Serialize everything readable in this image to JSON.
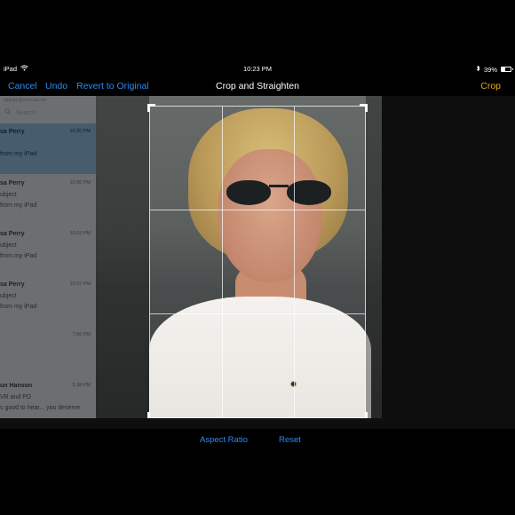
{
  "status_bar": {
    "device": "iPad",
    "time": "10:23 PM",
    "battery_percent_text": "39%",
    "battery_level": 0.39,
    "wifi_icon": "wifi-icon",
    "bluetooth_icon": "bluetooth-icon"
  },
  "nav": {
    "cancel_label": "Cancel",
    "undo_label": "Undo",
    "revert_label": "Revert to Original",
    "title": "Crop and Straighten",
    "crop_label": "Crop"
  },
  "photo": {
    "mail_panel": {
      "account_text": "mpcate@comcast.net",
      "search_placeholder": "Search",
      "items": [
        {
          "sender": "sa Perry",
          "time": "10:20 PM",
          "line2": "",
          "line3": "from my iPad"
        },
        {
          "sender": "sa Perry",
          "time": "10:06 PM",
          "line2": "ubject",
          "line3": "from my iPad"
        },
        {
          "sender": "sa Perry",
          "time": "10:03 PM",
          "line2": "ubject",
          "line3": "from my iPad"
        },
        {
          "sender": "sa Perry",
          "time": "10:07 PM",
          "line2": "ubject",
          "line3": "from my iPad"
        },
        {
          "sender": "",
          "time": "7:56 PM",
          "line2": "",
          "line3": ""
        },
        {
          "sender": "un Hanson",
          "time": "5:38 PM",
          "line2": "VR and PD",
          "line3": "s good to hear... you deserve"
        }
      ]
    }
  },
  "toolbar": {
    "aspect_ratio_label": "Aspect Ratio",
    "reset_label": "Reset"
  },
  "colors": {
    "accent_blue": "#2f8bf0",
    "crop_orange": "#f1a81b",
    "background": "#000000"
  }
}
